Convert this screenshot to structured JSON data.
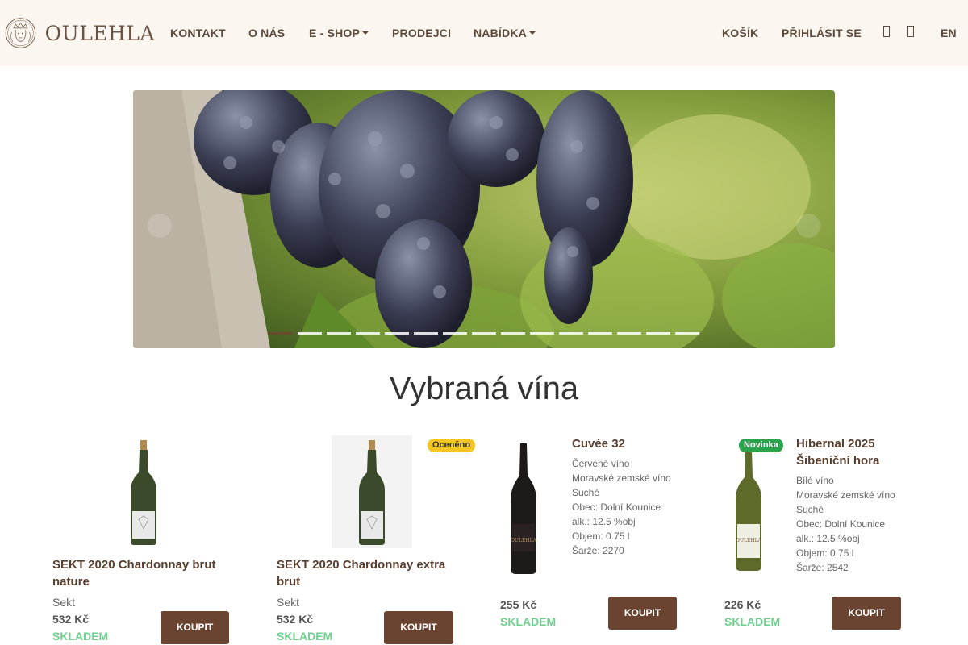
{
  "brand": {
    "name": "OULEHLA"
  },
  "nav": {
    "kontakt": "KONTAKT",
    "o_nas": "O NÁS",
    "eshop": "E - SHOP",
    "prodejci": "PRODEJCI",
    "nabidka": "NABÍDKA",
    "kosik": "KOŠÍK",
    "prihlasit": "PŘIHLÁSIT SE",
    "lang": "EN",
    "icon1": "user-icon",
    "icon2": "cart-icon"
  },
  "carousel": {
    "slide_count": 15,
    "active_index": 0
  },
  "section": {
    "title": "Vybraná vína"
  },
  "products": [
    {
      "name": "SEKT 2020 Chardonnay brut nature",
      "type": "Sekt",
      "price": "532 Kč",
      "stock": "SKLADEM",
      "button": "KOUPIT"
    },
    {
      "name": "SEKT 2020 Chardonnay extra brut",
      "type": "Sekt",
      "price": "532 Kč",
      "stock": "SKLADEM",
      "button": "KOUPIT",
      "badge": "Oceněno"
    },
    {
      "name": "Cuvée 32",
      "color_type": "Červené víno",
      "origin": "Moravské zemské víno",
      "sweetness": "Suché",
      "village": "Obec: Dolní Kounice",
      "alcohol": "alk.: 12.5 %obj",
      "volume": "Objem: 0.75 l",
      "batch": "Šarže: 2270",
      "price": "255 Kč",
      "stock": "SKLADEM",
      "button": "KOUPIT"
    },
    {
      "name": "Hibernal 2025 Šibeniční hora",
      "color_type": "Bílé víno",
      "origin": "Moravské zemské víno",
      "sweetness": "Suché",
      "village": "Obec: Dolní Kounice",
      "alcohol": "alk.: 12.5 %obj",
      "volume": "Objem: 0.75 l",
      "batch": "Šarže: 2542",
      "price": "226 Kč",
      "stock": "SKLADEM",
      "button": "KOUPIT",
      "badge": "Novinka"
    }
  ],
  "colors": {
    "header_bg": "#fbf6f0",
    "brand_brown": "#5d4a3c",
    "button_brown": "#6a4430",
    "stock_green": "#6fcf8f",
    "badge_gold": "#f3c623",
    "badge_green": "#2aa34b"
  }
}
